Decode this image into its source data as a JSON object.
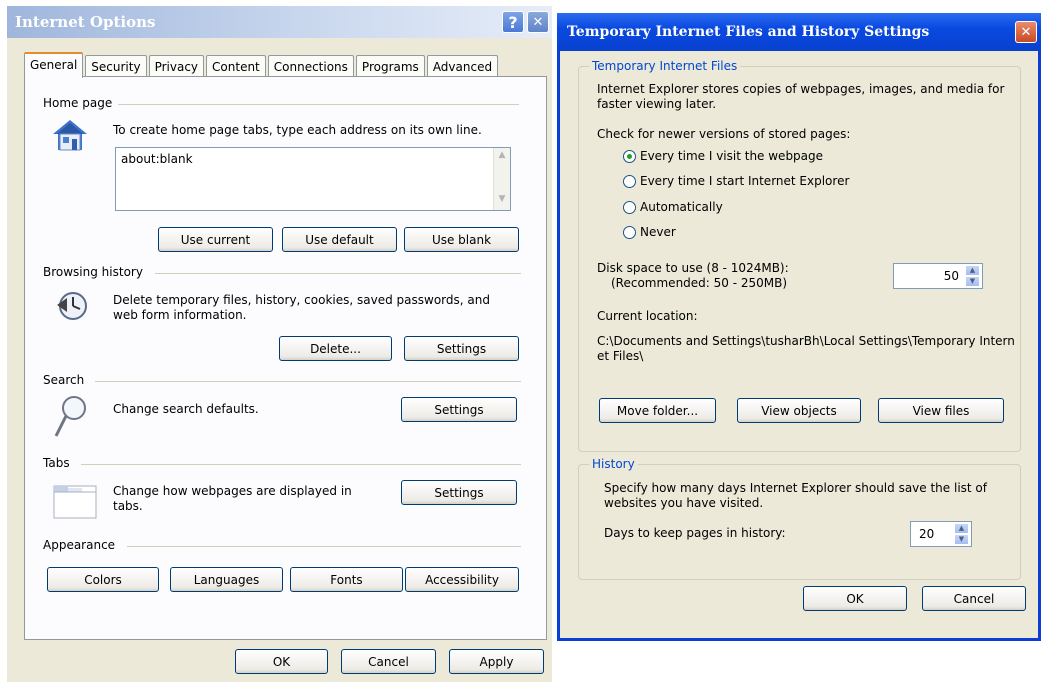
{
  "left_window": {
    "title": "Internet Options",
    "help_glyph": "?",
    "close_glyph": "✕",
    "tabs": [
      "General",
      "Security",
      "Privacy",
      "Content",
      "Connections",
      "Programs",
      "Advanced"
    ],
    "home_page": {
      "label": "Home page",
      "description": "To create home page tabs, type each address on its own line.",
      "value": "about:blank",
      "buttons": [
        "Use current",
        "Use default",
        "Use blank"
      ]
    },
    "browsing_history": {
      "label": "Browsing history",
      "description": "Delete temporary files, history, cookies, saved passwords, and web form information.",
      "delete_label": "Delete...",
      "settings_label": "Settings"
    },
    "search": {
      "label": "Search",
      "description": "Change search defaults.",
      "settings_label": "Settings"
    },
    "tabs_group": {
      "label": "Tabs",
      "description": "Change how webpages are displayed in tabs.",
      "settings_label": "Settings"
    },
    "appearance": {
      "label": "Appearance",
      "buttons": [
        "Colors",
        "Languages",
        "Fonts",
        "Accessibility"
      ]
    },
    "footer": {
      "ok": "OK",
      "cancel": "Cancel",
      "apply": "Apply"
    }
  },
  "right_window": {
    "title": "Temporary Internet Files and History Settings",
    "close_glyph": "✕",
    "tif": {
      "legend": "Temporary Internet Files",
      "description": "Internet Explorer stores copies of webpages, images, and media for faster viewing later.",
      "check_label": "Check for newer versions of stored pages:",
      "options": [
        "Every time I visit the webpage",
        "Every time I start Internet Explorer",
        "Automatically",
        "Never"
      ],
      "selected_index": 0,
      "disk_label_1": "Disk space to use (8 - 1024MB):",
      "disk_label_2": "(Recommended: 50 - 250MB)",
      "disk_value": "50",
      "current_location_label": "Current location:",
      "current_location": "C:\\Documents and Settings\\tusharBh\\Local Settings\\Temporary Internet Files\\",
      "buttons": [
        "Move folder...",
        "View objects",
        "View files"
      ]
    },
    "history": {
      "legend": "History",
      "description": "Specify how many days Internet Explorer should save the list of websites you have visited.",
      "days_label": "Days to keep pages in history:",
      "days_value": "20"
    },
    "footer": {
      "ok": "OK",
      "cancel": "Cancel"
    }
  },
  "colors": {
    "title_blue": "#0a49e0",
    "legend_blue": "#0046d5",
    "dialog_bg": "#ece9d8"
  }
}
